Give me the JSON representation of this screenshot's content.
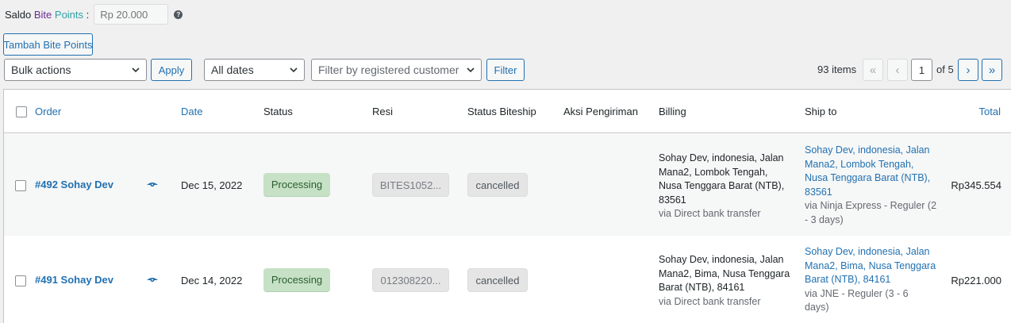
{
  "saldo": {
    "label_prefix": "Saldo ",
    "label_bite": "Bite",
    "label_points": " Points",
    "label_suffix": " :",
    "placeholder": "Rp 20.000",
    "help_glyph": "?"
  },
  "toolbar": {
    "tambah_label": "Tambah Bite Points",
    "bulk_actions": "Bulk actions",
    "apply_label": "Apply",
    "dates": "All dates",
    "customer_filter": "Filter by registered customer",
    "filter_label": "Filter"
  },
  "pagination": {
    "items": "93 items",
    "first": "«",
    "prev": "‹",
    "current": "1",
    "of": "of 5",
    "next": "›",
    "last": "»"
  },
  "columns": {
    "order": "Order",
    "date": "Date",
    "status": "Status",
    "resi": "Resi",
    "status_biteship": "Status Biteship",
    "aksi": "Aksi Pengiriman",
    "billing": "Billing",
    "ship_to": "Ship to",
    "total": "Total"
  },
  "orders": [
    {
      "order": "#492 Sohay Dev",
      "date": "Dec 15, 2022",
      "status": "Processing",
      "resi": "BITES1052...",
      "status_biteship": "cancelled",
      "billing_lines": [
        "Sohay Dev, indonesia, Jalan",
        "Mana2, Lombok Tengah,",
        "Nusa Tenggara Barat (NTB),",
        "83561"
      ],
      "billing_via": "via Direct bank transfer",
      "ship_lines": [
        "Sohay Dev, indonesia, Jalan",
        "Mana2, Lombok Tengah,",
        "Nusa Tenggara Barat (NTB),",
        "83561"
      ],
      "ship_via_lines": [
        "via Ninja Express - Reguler (2",
        "- 3 days)"
      ],
      "total": "Rp345.554"
    },
    {
      "order": "#491 Sohay Dev",
      "date": "Dec 14, 2022",
      "status": "Processing",
      "resi": "012308220...",
      "status_biteship": "cancelled",
      "billing_lines": [
        "Sohay Dev, indonesia, Jalan",
        "Mana2, Bima, Nusa Tenggara",
        "Barat (NTB), 84161"
      ],
      "billing_via": "via Direct bank transfer",
      "ship_lines": [
        "Sohay Dev, indonesia, Jalan",
        "Mana2, Bima, Nusa Tenggara",
        "Barat (NTB), 84161"
      ],
      "ship_via_lines": [
        "via JNE - Reguler (3 - 6",
        "days)"
      ],
      "total": "Rp221.000"
    }
  ]
}
